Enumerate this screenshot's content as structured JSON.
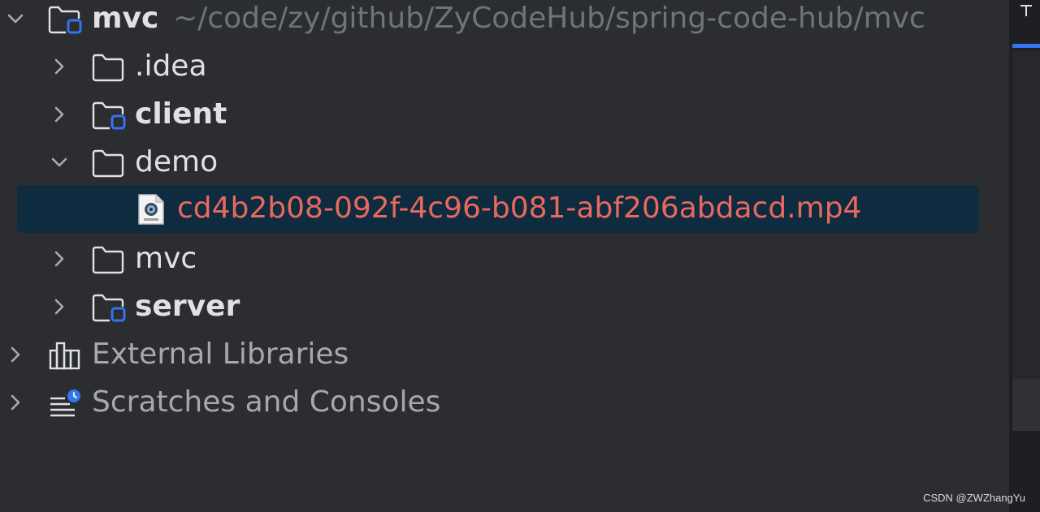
{
  "tree": {
    "root": {
      "name": "mvc",
      "path": "~/code/zy/github/ZyCodeHub/spring-code-hub/mvc",
      "expanded": true,
      "icon": "module-folder-icon",
      "children": [
        {
          "name": ".idea",
          "expanded": false,
          "icon": "folder-icon",
          "bold": false
        },
        {
          "name": "client",
          "expanded": false,
          "icon": "module-folder-icon",
          "bold": true
        },
        {
          "name": "demo",
          "expanded": true,
          "icon": "folder-icon",
          "bold": false,
          "children": [
            {
              "name": "cd4b2b08-092f-4c96-b081-abf206abdacd.mp4",
              "icon": "mp4-file-icon",
              "selected": true,
              "color": "#e8695d"
            }
          ]
        },
        {
          "name": "mvc",
          "expanded": false,
          "icon": "folder-icon",
          "bold": false
        },
        {
          "name": "server",
          "expanded": false,
          "icon": "module-folder-icon",
          "bold": true
        }
      ]
    },
    "external_libraries": {
      "label": "External Libraries",
      "icon": "library-icon",
      "expanded": false
    },
    "scratches": {
      "label": "Scratches and Consoles",
      "icon": "scratches-icon",
      "expanded": false
    }
  },
  "watermark": "CSDN @ZWZhangYu",
  "colors": {
    "background": "#2b2d30",
    "selection": "#0e2b40",
    "text": "#dfe1e5",
    "path": "#6f737a",
    "unversioned_file": "#e8695d",
    "module_badge": "#3574f0"
  }
}
